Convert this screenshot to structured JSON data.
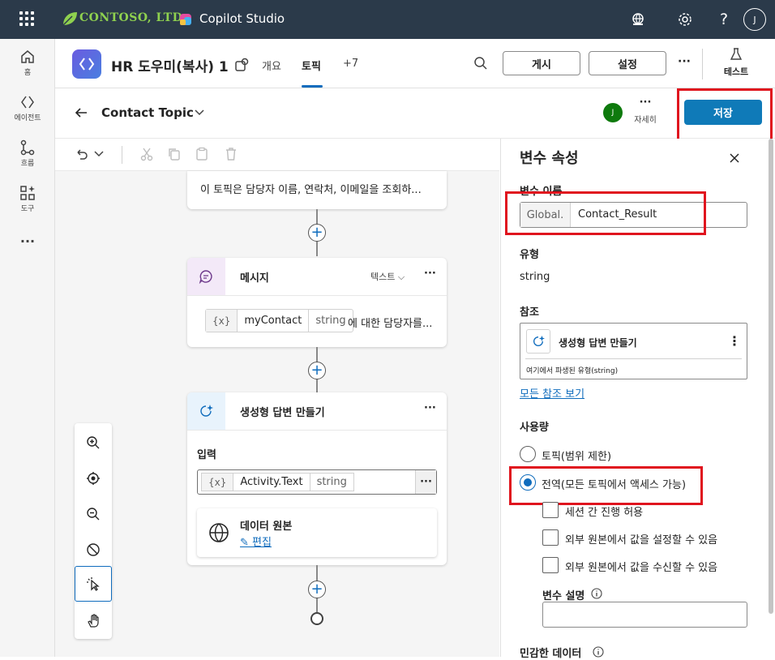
{
  "topbar": {
    "brand": "CONTOSO, LTD.",
    "product": "Copilot Studio",
    "avatar_initial": "J"
  },
  "leftnav": {
    "items": [
      {
        "label": "홈"
      },
      {
        "label": "에이전트"
      },
      {
        "label": "흐름"
      },
      {
        "label": "도구"
      }
    ],
    "more": "···"
  },
  "header": {
    "agent_title": "HR 도우미(복사) 1",
    "tabs": [
      {
        "label": "개요"
      },
      {
        "label": "토픽"
      },
      {
        "label": "+7"
      }
    ],
    "publish_label": "게시",
    "settings_label": "설정",
    "more": "···",
    "test_label": "테스트"
  },
  "subheader": {
    "topic_name": "Contact Topic",
    "avatar_initial": "J",
    "details_label": "자세히",
    "more": "···",
    "save_label": "저장"
  },
  "canvas": {
    "trigger_card": {
      "description": "이 토픽은 담당자 이름, 연락처, 이메일을 조회하..."
    },
    "message_card": {
      "title": "메시지",
      "type_label": "텍스트",
      "more": "···",
      "var_icon": "{x}",
      "var_name": "myContact",
      "var_type": "string",
      "suffix_text": "에 대한 담당자를..."
    },
    "generative_card": {
      "title": "생성형 답변 만들기",
      "more": "···",
      "input_label": "입력",
      "var_icon": "{x}",
      "var_name": "Activity.Text",
      "var_type": "string",
      "chip_more": "···",
      "datasource_title": "데이터 원본",
      "edit_label": "편집"
    }
  },
  "panel": {
    "title": "변수 속성",
    "var_name_label": "변수 이름",
    "var_prefix": "Global.",
    "var_name_value": "Contact_Result",
    "type_label": "유형",
    "type_value": "string",
    "reference_label": "참조",
    "reference_item": "생성형 답변 만들기",
    "reference_sub": "여기에서 파생된 유형(string)",
    "reference_more": "⋮",
    "view_all_refs": "모든 참조 보기",
    "usage_label": "사용량",
    "scope_topic": "토픽(범위 제한)",
    "scope_global": "전역(모든 토픽에서 액세스 가능)",
    "option_session": "세션 간 진행 허용",
    "option_external_set": "외부 원본에서 값을 설정할 수 있음",
    "option_external_receive": "외부 원본에서 값을 수신할 수 있음",
    "description_label": "변수 설명",
    "sensitive_label": "민감한 데이터"
  },
  "colors": {
    "topbar": "#2b3a4a",
    "accent": "#0f6cbd",
    "save_button": "#0f7ab8",
    "highlight": "#e0141e"
  }
}
